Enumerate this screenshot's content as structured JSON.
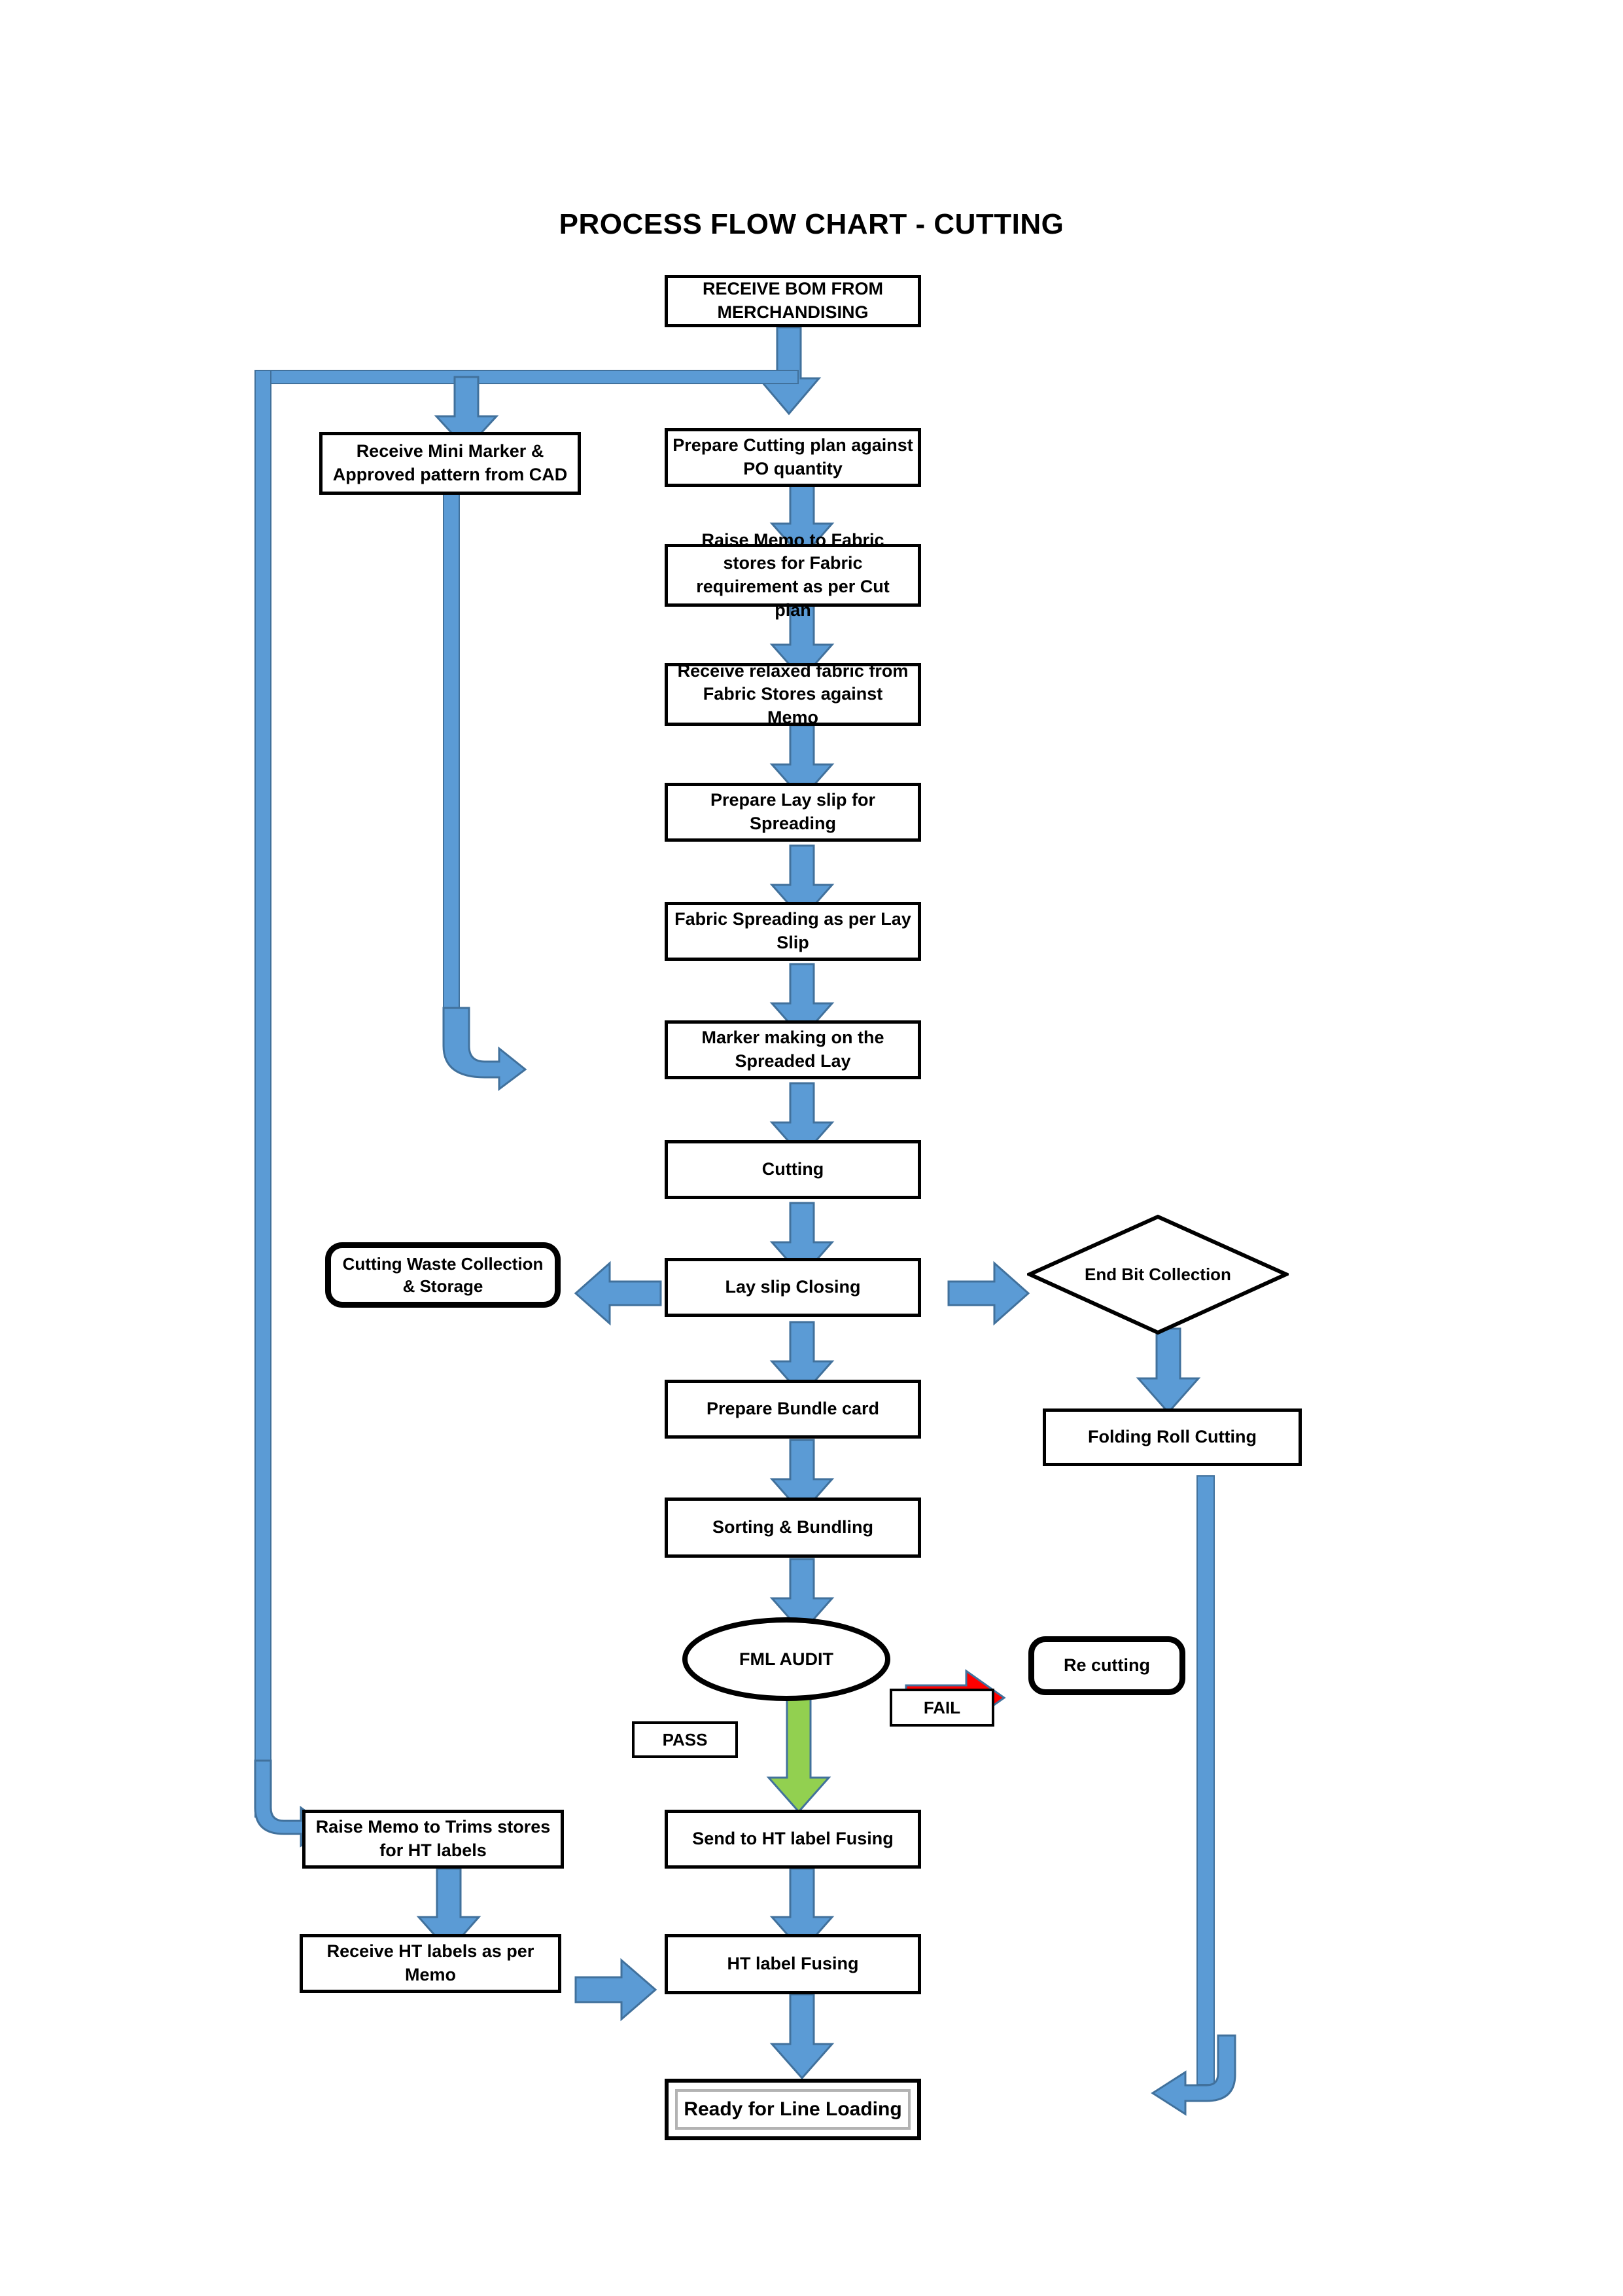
{
  "title": "PROCESS FLOW CHART - CUTTING",
  "colors": {
    "arrow_blue_fill": "#5B9BD5",
    "arrow_blue_stroke": "#41719C",
    "arrow_green_fill": "#92D050",
    "arrow_green_stroke": "#41719C",
    "arrow_red_fill": "#FF0000",
    "arrow_red_stroke": "#41719C",
    "shape_border": "#000000",
    "terminal_inner_border": "#B3B3B3",
    "background": "#FFFFFF"
  },
  "nodes": {
    "receive_bom": {
      "label": "RECEIVE BOM FROM MERCHANDISING",
      "shape": "rectangle"
    },
    "receive_mini_marker": {
      "label": "Receive Mini Marker & Approved pattern from CAD",
      "shape": "rectangle"
    },
    "prepare_cutting_plan": {
      "label": "Prepare Cutting plan against PO quantity",
      "shape": "rectangle"
    },
    "raise_memo_fabric": {
      "label": "Raise Memo to Fabric stores for Fabric requirement as per Cut plan",
      "shape": "rectangle"
    },
    "receive_relaxed_fabric": {
      "label": "Receive relaxed fabric from Fabric Stores against Memo",
      "shape": "rectangle"
    },
    "prepare_lay_slip": {
      "label": "Prepare Lay slip for Spreading",
      "shape": "rectangle"
    },
    "fabric_spreading": {
      "label": "Fabric Spreading as per Lay Slip",
      "shape": "rectangle"
    },
    "marker_making": {
      "label": "Marker making on the Spreaded Lay",
      "shape": "rectangle"
    },
    "cutting": {
      "label": "Cutting",
      "shape": "rectangle"
    },
    "cutting_waste": {
      "label": "Cutting Waste Collection & Storage",
      "shape": "rounded-rectangle"
    },
    "lay_slip_closing": {
      "label": "Lay slip Closing",
      "shape": "rectangle"
    },
    "end_bit_collection": {
      "label": "End Bit Collection",
      "shape": "diamond"
    },
    "folding_roll_cutting": {
      "label": "Folding Roll Cutting",
      "shape": "rectangle"
    },
    "prepare_bundle_card": {
      "label": "Prepare Bundle card",
      "shape": "rectangle"
    },
    "sorting_bundling": {
      "label": "Sorting & Bundling",
      "shape": "rectangle"
    },
    "fml_audit": {
      "label": "FML AUDIT",
      "shape": "ellipse"
    },
    "re_cutting": {
      "label": "Re cutting",
      "shape": "rounded-rectangle"
    },
    "pass_label": {
      "label": "PASS",
      "shape": "rectangle"
    },
    "fail_label": {
      "label": "FAIL",
      "shape": "rectangle"
    },
    "raise_memo_trims": {
      "label": "Raise Memo to Trims stores for HT labels",
      "shape": "rectangle"
    },
    "send_to_ht_fusing": {
      "label": "Send to HT label Fusing",
      "shape": "rectangle"
    },
    "receive_ht_labels": {
      "label": "Receive HT labels as per Memo",
      "shape": "rectangle"
    },
    "ht_label_fusing": {
      "label": "HT label Fusing",
      "shape": "rectangle"
    },
    "ready_for_line_loading": {
      "label": "Ready for Line Loading",
      "shape": "terminator"
    }
  },
  "chart_data": {
    "type": "flowchart",
    "title": "PROCESS FLOW CHART - CUTTING",
    "orientation": "top-to-bottom",
    "steps": [
      "RECEIVE BOM FROM MERCHANDISING",
      "Prepare Cutting plan against PO quantity",
      "Raise Memo to Fabric stores for Fabric requirement as per Cut plan",
      "Receive relaxed fabric from Fabric Stores against Memo",
      "Prepare Lay slip for Spreading",
      "Fabric Spreading as per Lay Slip",
      "Marker making on the Spreaded Lay",
      "Cutting",
      "Lay slip Closing",
      "Prepare Bundle card",
      "Sorting & Bundling",
      "FML AUDIT",
      "Send to HT label Fusing",
      "HT label Fusing",
      "Ready for Line Loading"
    ],
    "branches": [
      {
        "from": "RECEIVE BOM FROM MERCHANDISING",
        "to": "Receive Mini Marker & Approved pattern from CAD",
        "label": ""
      },
      {
        "from": "Lay slip Closing",
        "to": "Cutting Waste Collection & Storage",
        "label": "",
        "direction": "left"
      },
      {
        "from": "Lay slip Closing",
        "to": "End Bit Collection",
        "label": "",
        "direction": "right"
      },
      {
        "from": "End Bit Collection",
        "to": "Folding Roll Cutting",
        "label": ""
      },
      {
        "from": "FML AUDIT",
        "to": "Re cutting",
        "label": "FAIL",
        "color": "#FF0000"
      },
      {
        "from": "FML AUDIT",
        "to": "Send to HT label Fusing",
        "label": "PASS",
        "color": "#92D050"
      },
      {
        "from": "Receive Mini Marker & Approved pattern from CAD",
        "to": "Raise Memo to Trims stores for HT labels",
        "label": ""
      },
      {
        "from": "Raise Memo to Trims stores for HT labels",
        "to": "Receive HT labels as per Memo",
        "label": ""
      },
      {
        "from": "Receive HT labels as per Memo",
        "to": "HT label Fusing",
        "label": "",
        "direction": "right"
      },
      {
        "from": "Folding Roll Cutting",
        "to": "Ready for Line Loading",
        "label": "",
        "direction": "down-left"
      }
    ]
  }
}
